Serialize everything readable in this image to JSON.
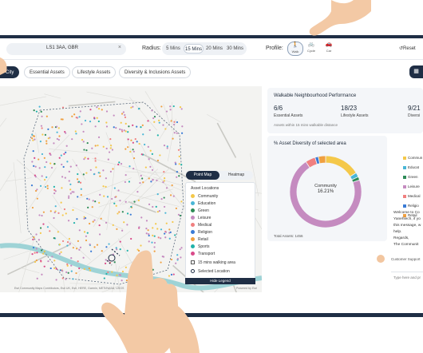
{
  "toolbar": {
    "search_value": "LS1 3AA, GBR",
    "search_clear": "×",
    "radius_label": "Radius:",
    "radius_options": [
      "5 Mins",
      "15 Mins",
      "20 Mins",
      "30 Mins"
    ],
    "radius_selected": "15 Mins",
    "profile_label": "Profile:",
    "profiles": [
      {
        "label": "Walk",
        "icon": "walk-icon",
        "glyph": "🚶"
      },
      {
        "label": "Cycle",
        "icon": "bicycle-icon",
        "glyph": "🚲"
      },
      {
        "label": "Car",
        "icon": "car-icon",
        "glyph": "🚗"
      }
    ],
    "profile_selected": "Walk",
    "reset_label": "↺Reset"
  },
  "tabs": {
    "items": [
      "City",
      "Essential Assets",
      "Lifestyle Assets",
      "Diversity & Inclusions Assets"
    ],
    "active": "City"
  },
  "map": {
    "toggle_options": [
      "Point Map",
      "Heatmap"
    ],
    "toggle_selected": "Point Map",
    "legend_title": "Asset Locations",
    "legend_items": [
      {
        "label": "Community",
        "color": "#f4c84a"
      },
      {
        "label": "Education",
        "color": "#49b6d6"
      },
      {
        "label": "Green",
        "color": "#2e8b57"
      },
      {
        "label": "Leisure",
        "color": "#c58bc0"
      },
      {
        "label": "Medical",
        "color": "#f08080"
      },
      {
        "label": "Religion",
        "color": "#3a7bd5"
      },
      {
        "label": "Retail",
        "color": "#f0a040"
      },
      {
        "label": "Sports",
        "color": "#20b2aa"
      },
      {
        "label": "Transport",
        "color": "#d94b8a"
      }
    ],
    "walk_area_label": "15 mins walking area",
    "selected_location_label": "Selected Location",
    "hide_legend_label": "Hide Legend",
    "attribution": "Esri Community Maps Contributors, Esri UK, Esri, HERE, Garmin, METI/NASA, USGS",
    "powered_by": "Powered by Esri"
  },
  "performance": {
    "title": "Walkable Neighbourhood Performance",
    "stats": [
      {
        "value": "6/6",
        "label": "Essential Assets"
      },
      {
        "value": "18/23",
        "label": "Lifestyle Assets"
      },
      {
        "value": "9/21",
        "label": "Diversi"
      }
    ],
    "note": "Assets within 15 mins walkable distance"
  },
  "diversity": {
    "title": "% Asset Diversity of selected area",
    "center_label": "Community",
    "center_value": "16.21%",
    "total_assets": "Total Assets: 1456"
  },
  "chart_data": {
    "type": "pie",
    "title": "% Asset Diversity of selected area",
    "series": [
      {
        "name": "Community",
        "value": 16.21,
        "color": "#f4c84a"
      },
      {
        "name": "Education",
        "value": 2.0,
        "color": "#49b6d6"
      },
      {
        "name": "Green",
        "value": 1.5,
        "color": "#2e8b57"
      },
      {
        "name": "Leisure",
        "value": 71.0,
        "color": "#c58bc0"
      },
      {
        "name": "Medical",
        "value": 4.5,
        "color": "#f08080"
      },
      {
        "name": "Religion",
        "value": 1.5,
        "color": "#3a7bd5"
      },
      {
        "name": "Retail",
        "value": 3.29,
        "color": "#f0a040"
      }
    ],
    "legend_labels": [
      "Commun",
      "Educat",
      "Green",
      "Leisure",
      "Medical",
      "Religio",
      "Retail"
    ]
  },
  "chat": {
    "lines": [
      "Welcome to Co",
      "Yanehlech, if yo",
      "this message, w",
      "help.",
      "Regards,",
      "The Communit"
    ],
    "agent_label": "Customer Support",
    "input_placeholder": "Type here and pr"
  }
}
